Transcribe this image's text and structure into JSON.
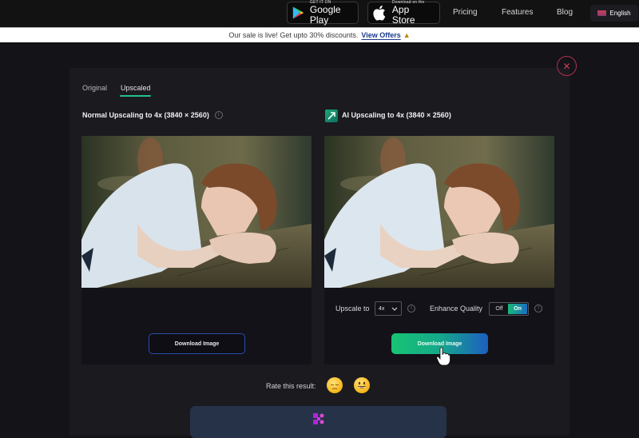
{
  "topnav": {
    "google_play": {
      "sub": "GET IT ON",
      "main": "Google Play",
      "icon": "google-play-icon"
    },
    "app_store": {
      "sub": "Download on the",
      "main": "App Store",
      "icon": "apple-icon"
    },
    "links": [
      "Pricing",
      "Features",
      "Blog"
    ],
    "language": {
      "label": "English",
      "icon": "uk-flag-icon"
    }
  },
  "banner": {
    "text": "Our sale is live! Get upto 30% discounts.",
    "link": "View Offers",
    "icon": "party-popper-icon"
  },
  "modal": {
    "close_icon": "close-icon",
    "tabs": [
      {
        "label": "Original",
        "active": false
      },
      {
        "label": "Upscaled",
        "active": true
      }
    ],
    "left_panel": {
      "title": "Normal Upscaling to 4x (3840 × 2560)",
      "info_icon": "info-icon",
      "image_alt": "Woman resting head on arms on wooden table",
      "download_label": "Download Image"
    },
    "right_panel": {
      "title": "AI Upscaling to 4x (3840 × 2560)",
      "title_icon": "ai-upscale-icon",
      "image_alt": "Woman resting head on arms on wooden table (AI upscaled)",
      "upscale_label": "Upscale to",
      "upscale_value": "4x",
      "enhance_label": "Enhance Quality",
      "toggle_off": "Off",
      "toggle_on": "On",
      "enhance_state": "On",
      "download_label": "Download Image"
    },
    "rating": {
      "label": "Rate this result:",
      "options": [
        "sad-face-icon",
        "happy-face-icon"
      ]
    }
  },
  "colors": {
    "accent_green": "#22c28a",
    "close_red": "#d23a5e",
    "button_border_blue": "#2a4cae",
    "gradient_start": "#17c474",
    "gradient_end": "#1d5fc0"
  }
}
